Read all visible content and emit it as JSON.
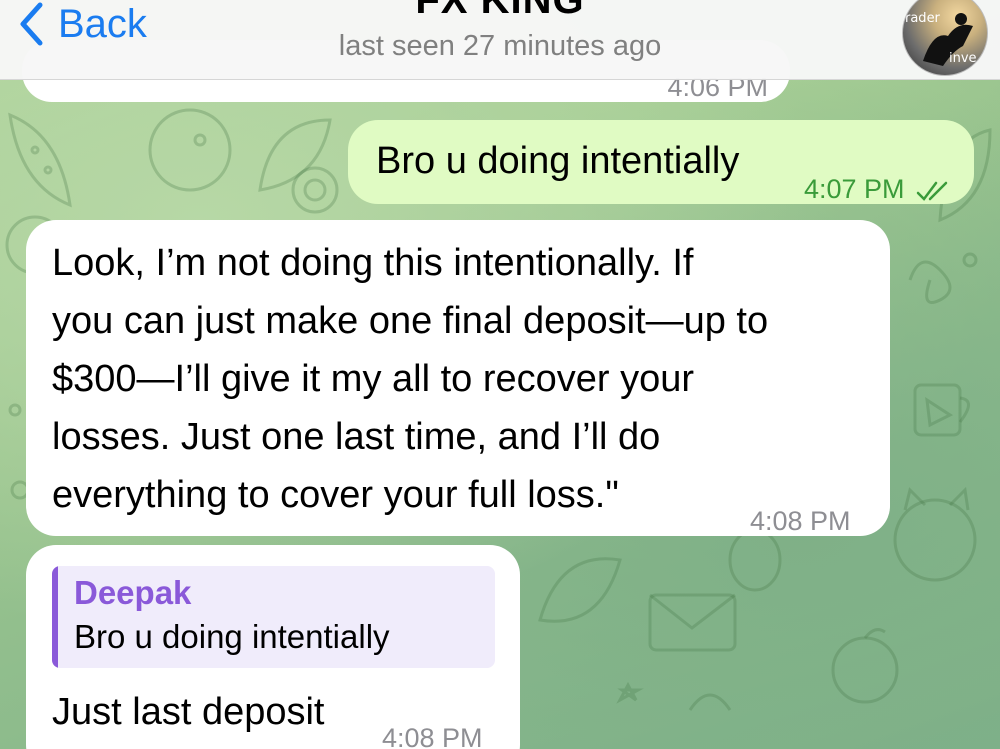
{
  "header": {
    "back_label": "Back",
    "title": "FX KING",
    "subtitle": "last seen 27 minutes ago",
    "avatar_text_1": "rader",
    "avatar_text_2": "inve"
  },
  "messages": [
    {
      "direction": "incoming",
      "partial": true,
      "time": "4:06 PM"
    },
    {
      "direction": "outgoing",
      "text": "Bro u doing intentially",
      "time": "4:07 PM",
      "status": "read"
    },
    {
      "direction": "incoming",
      "lines": [
        "Look, I’m not doing this intentionally. If",
        "you can just make one final deposit—up to",
        "$300—I’ll give it my all to recover your",
        "losses. Just one last time, and I’ll do",
        "everything to cover your full loss.\""
      ],
      "time": "4:08 PM"
    },
    {
      "direction": "incoming",
      "reply_to": {
        "name": "Deepak",
        "text": "Bro u doing intentially"
      },
      "text": "Just last deposit",
      "time": "4:08 PM"
    }
  ],
  "colors": {
    "accent": "#1a7cf0",
    "outgoing_bubble": "#e0fbc3",
    "incoming_bubble": "#ffffff",
    "reply_accent": "#8a59d9",
    "read_tick": "#3a9b3a"
  },
  "icons": [
    "chevron-left-icon",
    "double-check-icon"
  ]
}
